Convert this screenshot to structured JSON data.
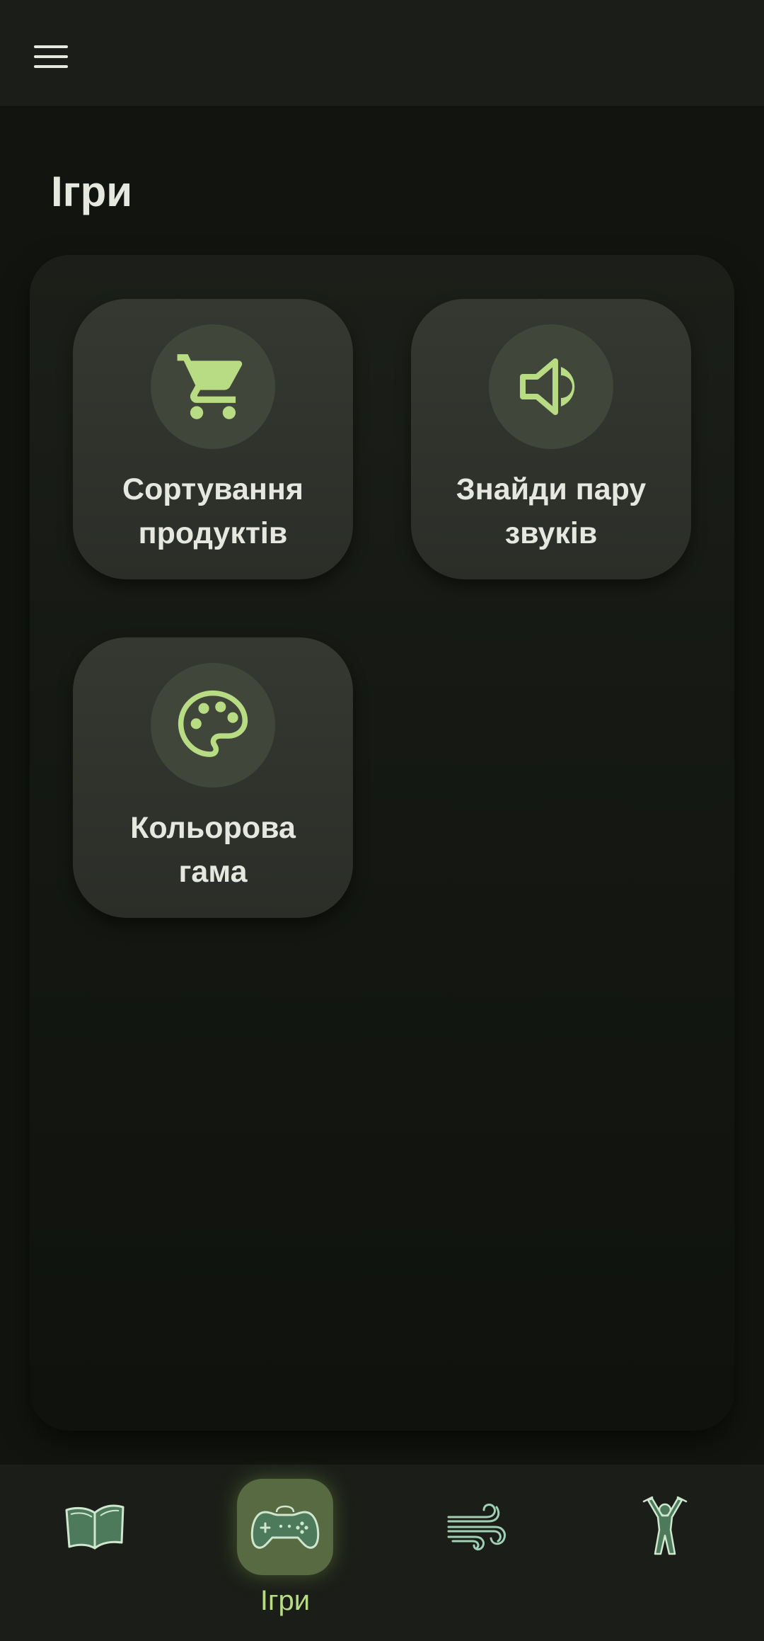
{
  "header": {
    "menu_icon": "hamburger-menu-icon"
  },
  "page": {
    "title": "Ігри"
  },
  "games": [
    {
      "label": "Сортування\nпродуктів",
      "icon": "shopping-cart-icon"
    },
    {
      "label": "Знайди пару\nзвуків",
      "icon": "speaker-volume-icon"
    },
    {
      "label": "Кольорова\nгама",
      "icon": "palette-icon"
    }
  ],
  "bottom_nav": {
    "items": [
      {
        "icon": "book-icon",
        "label": ""
      },
      {
        "icon": "gamepad-icon",
        "label": "Ігри",
        "active": true
      },
      {
        "icon": "wind-icon",
        "label": ""
      },
      {
        "icon": "exercise-person-icon",
        "label": ""
      }
    ]
  },
  "colors": {
    "accent": "#b8dc84",
    "background": "#12150f",
    "card": "#2f322c",
    "nav_active": "#586a42",
    "nav_icon": "#4e7a5c"
  }
}
